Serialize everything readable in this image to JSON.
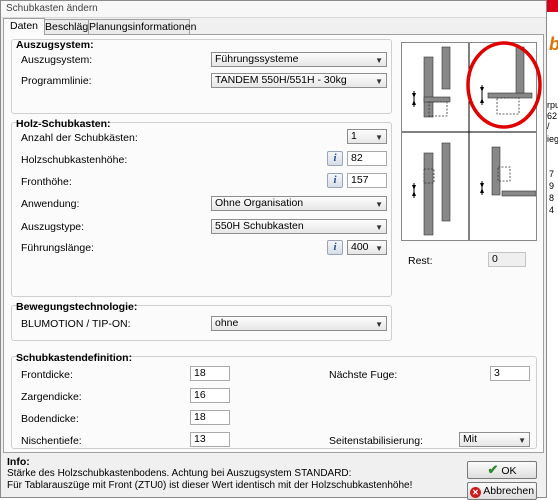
{
  "window": {
    "title": "Schubkasten ändern"
  },
  "tabs": [
    {
      "label": "Daten",
      "active": true
    },
    {
      "label": "Beschläge",
      "active": false
    },
    {
      "label": "Planungsinformationen",
      "active": false
    }
  ],
  "auszugsystem_group": {
    "title": "Auszugsystem:",
    "auszugsystem_label": "Auszugsystem:",
    "auszugsystem_value": "Führungssysteme",
    "programmlinie_label": "Programmlinie:",
    "programmlinie_value": "TANDEM 550H/551H - 30kg"
  },
  "holz_group": {
    "title": "Holz-Schubkasten:",
    "anzahl_label": "Anzahl der Schubkästen:",
    "anzahl_value": "1",
    "hoehe_label": "Holzschubkastenhöhe:",
    "hoehe_value": "82",
    "fronthoehe_label": "Fronthöhe:",
    "fronthoehe_value": "157",
    "anwendung_label": "Anwendung:",
    "anwendung_value": "Ohne Organisation",
    "auszugstype_label": "Auszugstype:",
    "auszugstype_value": "550H Schubkasten",
    "fuehrungslaenge_label": "Führungslänge:",
    "fuehrungslaenge_value": "400"
  },
  "bewegung_group": {
    "title": "Bewegungstechnologie:",
    "label": "BLUMOTION / TIP-ON:",
    "value": "ohne"
  },
  "definition_group": {
    "title": "Schubkastendefinition:",
    "frontdicke_label": "Frontdicke:",
    "frontdicke_value": "18",
    "zargendicke_label": "Zargendicke:",
    "zargendicke_value": "16",
    "bodendicke_label": "Bodendicke:",
    "bodendicke_value": "18",
    "nischentiefe_label": "Nischentiefe:",
    "nischentiefe_value": "13",
    "naechste_fuge_label": "Nächste Fuge:",
    "naechste_fuge_value": "3",
    "seitenstab_label": "Seitenstabilisierung:",
    "seitenstab_value": "Mit"
  },
  "rest": {
    "label": "Rest:",
    "value": "0"
  },
  "info": {
    "title": "Info:",
    "line1": "Stärke des Holzschubkastenbodens. Achtung bei Auszugsystem STANDARD:",
    "line2": "Für Tablarauszüge mit Front (ZTU0) ist dieser Wert identisch mit der Holzschubkastenhöhe!"
  },
  "buttons": {
    "ok": "OK",
    "cancel": "Abbrechen"
  },
  "background_window": {
    "letter": "b",
    "fragments": [
      "rpu",
      "62 /",
      "ieg",
      "7",
      "9",
      "8",
      "4"
    ]
  },
  "colors": {
    "accent_red": "#d9001b",
    "ok_green": "#2e8b2e",
    "cancel_red": "#c81e1e",
    "highlight_circle": "#e00000"
  },
  "icons": [
    "info-icon",
    "chevron-down-icon",
    "check-icon",
    "x-icon",
    "drawer-mount-diagram"
  ]
}
